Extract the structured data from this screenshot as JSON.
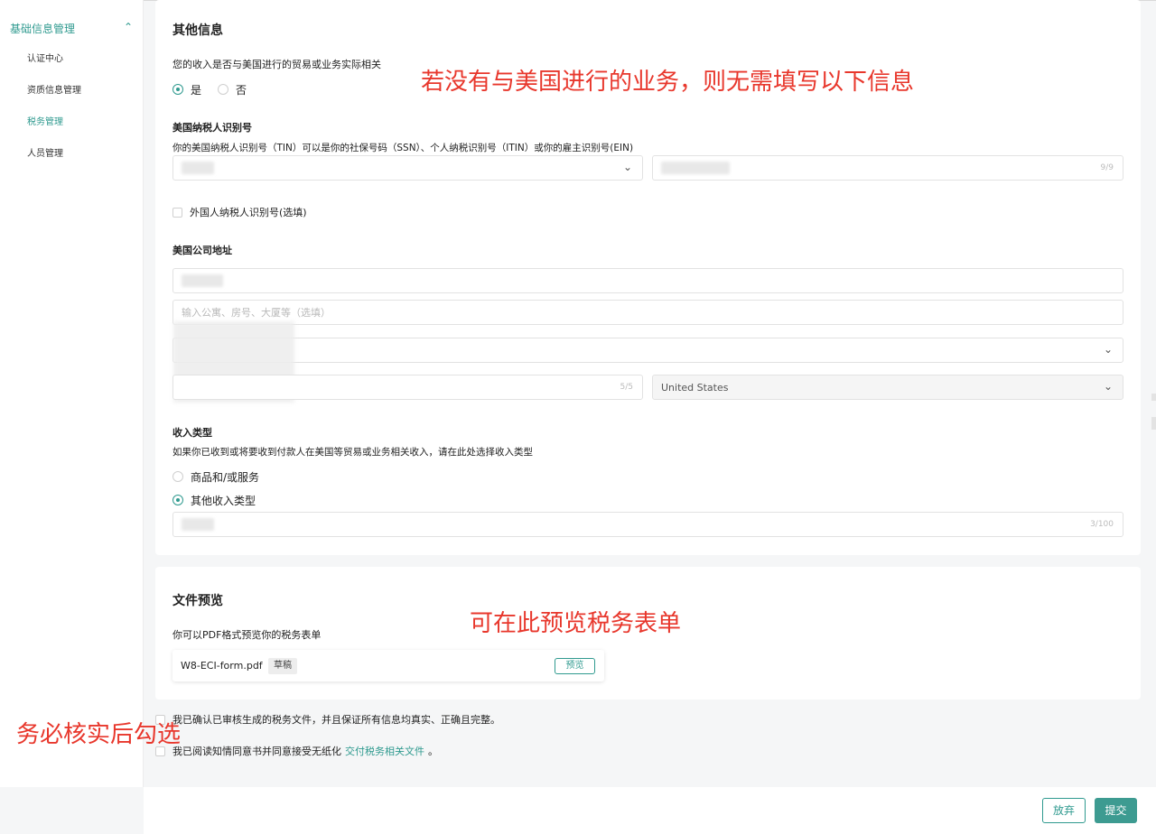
{
  "sidebar": {
    "group": "基础信息管理",
    "items": [
      {
        "label": "认证中心"
      },
      {
        "label": "资质信息管理"
      },
      {
        "label": "税务管理"
      },
      {
        "label": "人员管理"
      }
    ]
  },
  "other_info": {
    "title": "其他信息",
    "income_question": "您的收入是否与美国进行的贸易或业务实际相关",
    "yes": "是",
    "no": "否",
    "tin_title": "美国纳税人识别号",
    "tin_desc": "你的美国纳税人识别号（TIN）可以是你的社保号码（SSN）、个人纳税识别号（ITIN）或你的雇主识别号(EIN)",
    "tin_counter": "9/9",
    "foreign_tin": "外国人纳税人识别号(选填)",
    "address_title": "美国公司地址",
    "address2_placeholder": "输入公寓、房号、大厦等（选填）",
    "zip_counter": "5/5",
    "country": "United States",
    "income_type_title": "收入类型",
    "income_type_desc": "如果你已收到或将要收到付款人在美国等贸易或业务相关收入，请在此处选择收入类型",
    "option_goods": "商品和/或服务",
    "option_other": "其他收入类型",
    "other_counter": "3/100"
  },
  "file_preview": {
    "title": "文件预览",
    "desc": "你可以PDF格式预览你的税务表单",
    "file_name": "W8-ECI-form.pdf",
    "badge": "草稿",
    "preview_button": "预览"
  },
  "agreements": {
    "confirm": "我已确认已审核生成的税务文件，并且保证所有信息均真实、正确且完整。",
    "consent_prefix": "我已阅读知情同意书并同意接受无纸化",
    "consent_link": "交付税务相关文件",
    "consent_suffix": "。"
  },
  "annotations": {
    "no_us_business": "若没有与美国进行的业务，则无需填写以下信息",
    "preview_here": "可在此预览税务表单",
    "must_check": "务必核实后勾选"
  },
  "footer": {
    "cancel": "放弃",
    "submit": "提交"
  },
  "colors": {
    "accent": "#2f9a8f",
    "annotation": "#e8372c"
  }
}
